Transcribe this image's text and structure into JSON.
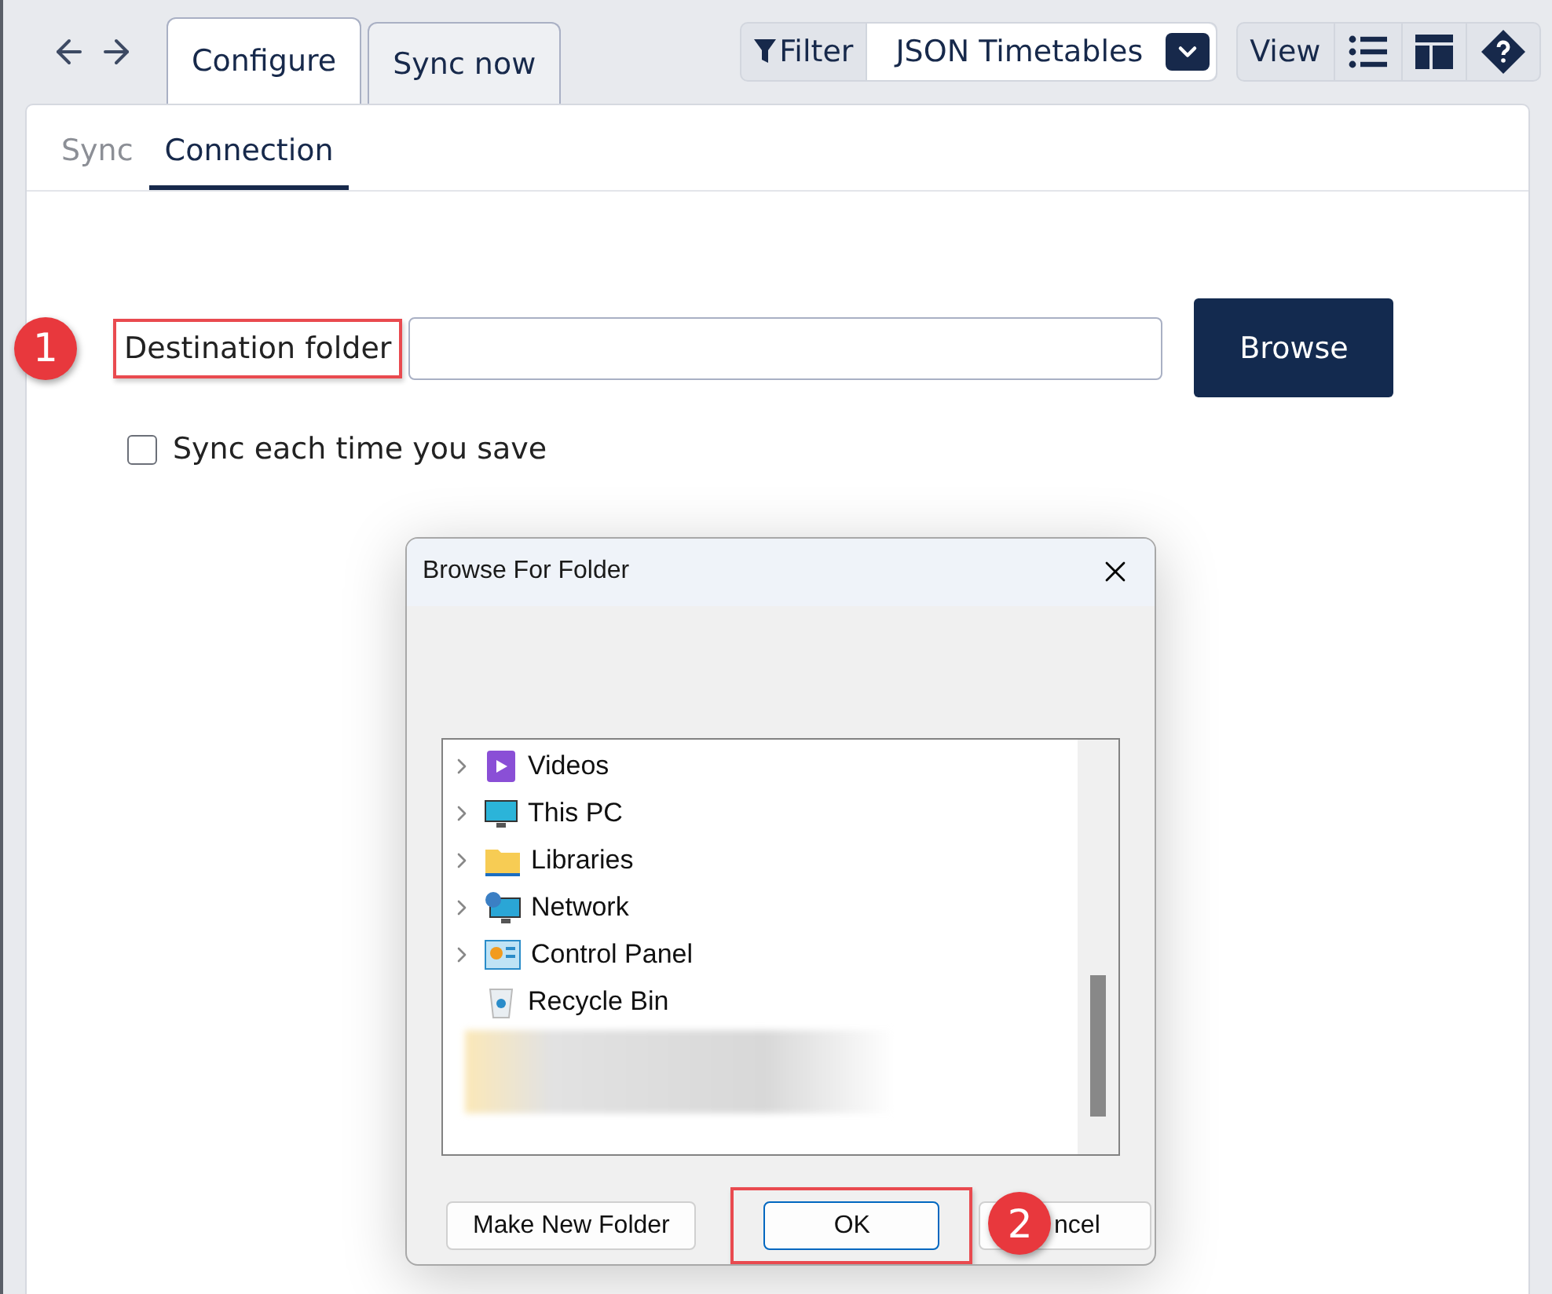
{
  "top_tabs": [
    {
      "label": "Configure",
      "selected": true
    },
    {
      "label": "Sync now",
      "selected": false
    }
  ],
  "filter": {
    "label": "Filter",
    "dropdown_value": "JSON Timetables"
  },
  "view": {
    "label": "View"
  },
  "sub_tabs": [
    {
      "label": "Sync",
      "selected": false
    },
    {
      "label": "Connection",
      "selected": true
    }
  ],
  "form": {
    "label": "Destination folder",
    "browse_button": "Browse",
    "checkbox": {
      "label": "Sync each time you save",
      "checked": false
    }
  },
  "dialog": {
    "title": "Browse For Folder",
    "tree": [
      {
        "label": "Videos",
        "kind": "videos",
        "expandable": true
      },
      {
        "label": "This PC",
        "kind": "pc",
        "expandable": true
      },
      {
        "label": "Libraries",
        "kind": "folder",
        "expandable": true
      },
      {
        "label": "Network",
        "kind": "network",
        "expandable": true
      },
      {
        "label": "Control Panel",
        "kind": "control-panel",
        "expandable": true
      },
      {
        "label": "Recycle Bin",
        "kind": "recycle-bin",
        "expandable": false
      }
    ],
    "buttons": [
      {
        "label": "Make New Folder",
        "highlighted": false
      },
      {
        "label": "OK",
        "highlighted": true
      },
      {
        "label": "ncel",
        "highlighted": false
      }
    ]
  },
  "callouts": [
    "1",
    "2"
  ]
}
